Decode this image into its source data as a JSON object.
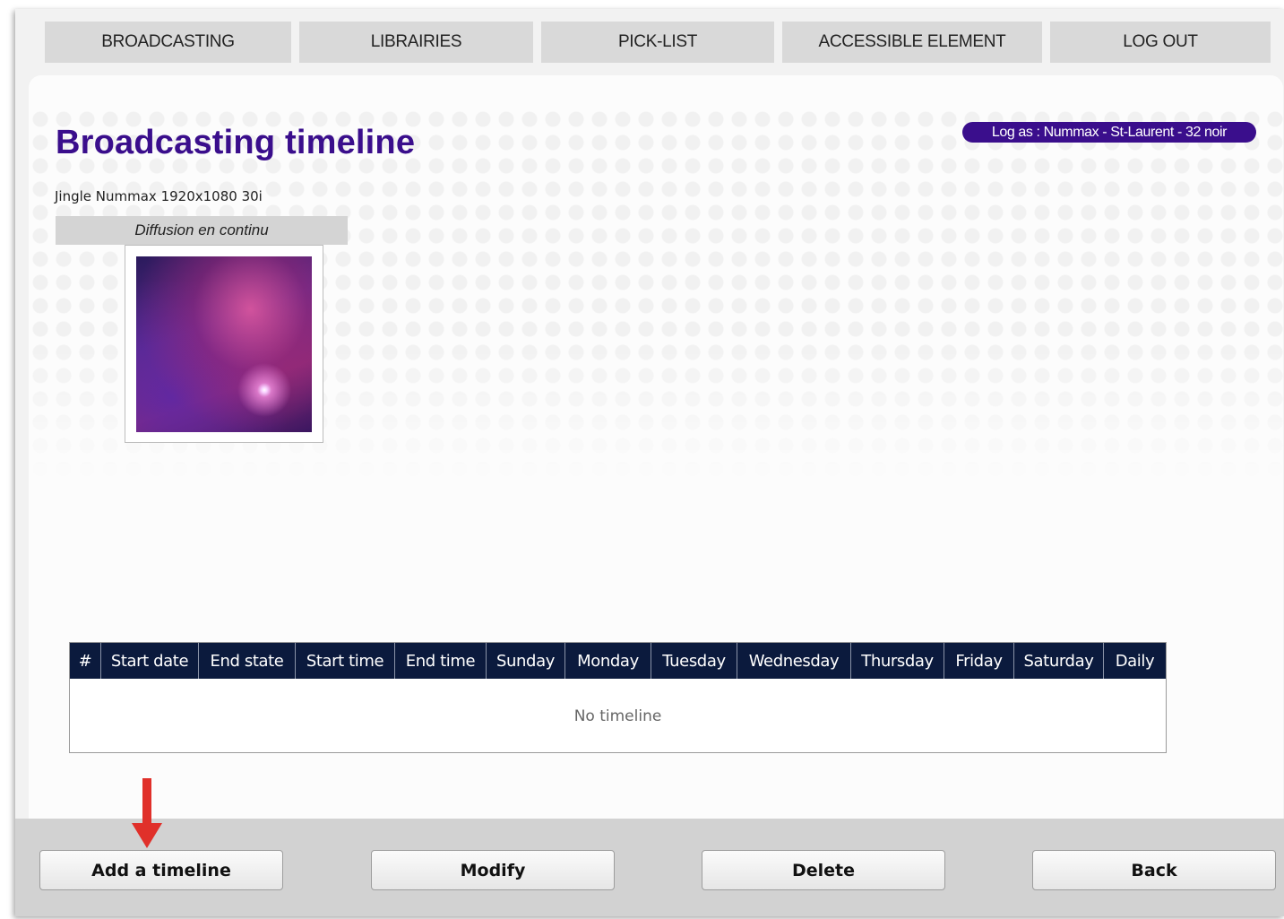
{
  "nav": {
    "items": [
      "BROADCASTING",
      "LIBRAIRIES",
      "PICK-LIST",
      "ACCESSIBLE ELEMENT",
      "LOG OUT"
    ]
  },
  "header": {
    "title": "Broadcasting timeline",
    "log_badge": "Log as : Nummax - St-Laurent - 32 noir"
  },
  "media": {
    "name": "Jingle Nummax 1920x1080 30i",
    "mode_label": "Diffusion en continu"
  },
  "table": {
    "columns": [
      "#",
      "Start date",
      "End state",
      "Start time",
      "End time",
      "Sunday",
      "Monday",
      "Tuesday",
      "Wednesday",
      "Thursday",
      "Friday",
      "Saturday",
      "Daily"
    ],
    "empty_message": "No timeline"
  },
  "footer": {
    "add_label": "Add a timeline",
    "modify_label": "Modify",
    "delete_label": "Delete",
    "back_label": "Back"
  },
  "colors": {
    "title": "#3a0e8c",
    "table_header": "#0b1a3d",
    "annotation_arrow": "#e0302a"
  }
}
